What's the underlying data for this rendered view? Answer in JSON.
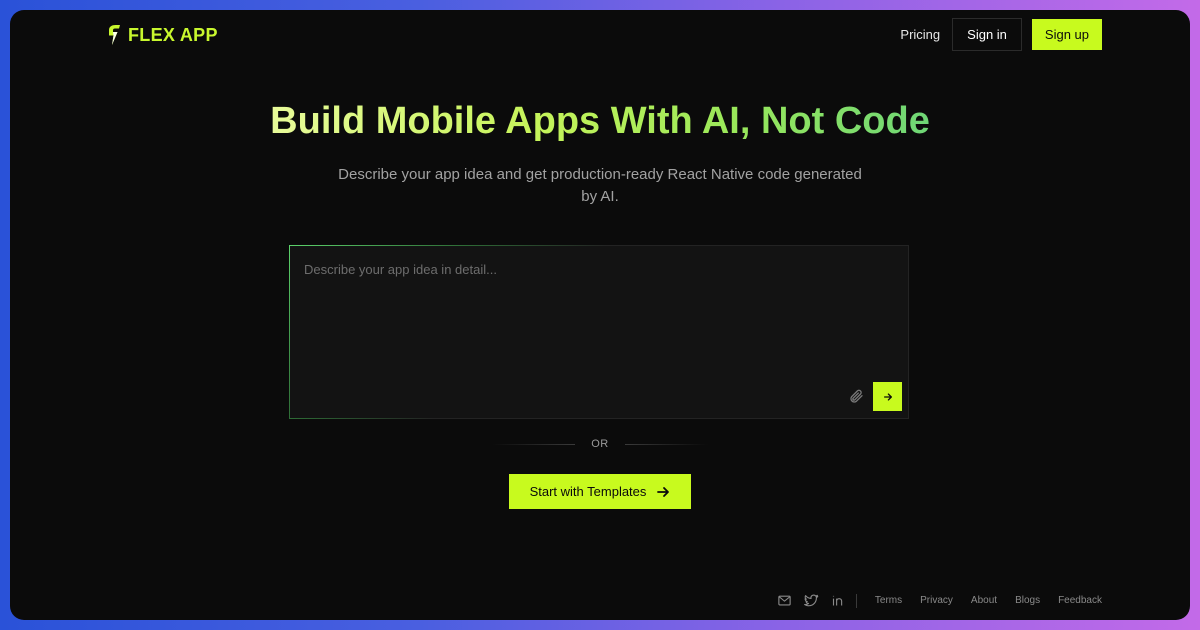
{
  "header": {
    "logo_text": "FLEX APP",
    "nav": {
      "pricing": "Pricing",
      "sign_in": "Sign in",
      "sign_up": "Sign up"
    }
  },
  "hero": {
    "title": "Build Mobile Apps With AI, Not Code",
    "subtitle": "Describe your app idea and get production-ready React Native code generated by AI."
  },
  "prompt": {
    "placeholder": "Describe your app idea in detail...",
    "value": ""
  },
  "divider": {
    "text": "OR"
  },
  "templates_button": {
    "label": "Start with Templates"
  },
  "footer": {
    "links": [
      "Terms",
      "Privacy",
      "About",
      "Blogs",
      "Feedback"
    ],
    "social_icons": [
      "mail-icon",
      "twitter-icon",
      "linkedin-icon"
    ]
  },
  "colors": {
    "accent": "#c8fa1e",
    "background": "#0b0b0b",
    "frame_gradient_start": "#2a52d8",
    "frame_gradient_end": "#c36ae8"
  }
}
